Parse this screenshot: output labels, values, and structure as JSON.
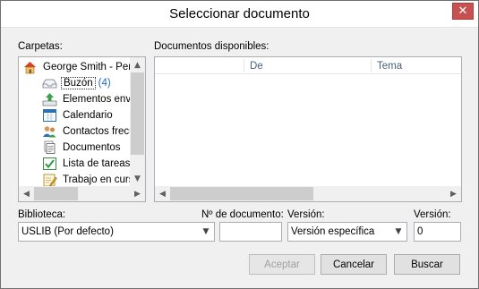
{
  "window": {
    "title": "Seleccionar documento",
    "close_glyph": "✕"
  },
  "folders": {
    "label": "Carpetas:",
    "items": [
      {
        "label": "George Smith - Perso",
        "icon": "home-icon",
        "count": ""
      },
      {
        "label": "Buzón",
        "icon": "inbox-icon",
        "count": "(4)"
      },
      {
        "label": "Elementos envia",
        "icon": "sent-items-icon",
        "count": ""
      },
      {
        "label": "Calendario",
        "icon": "calendar-icon",
        "count": ""
      },
      {
        "label": "Contactos frecue",
        "icon": "contacts-icon",
        "count": ""
      },
      {
        "label": "Documentos",
        "icon": "documents-icon",
        "count": ""
      },
      {
        "label": "Lista de tareas",
        "icon": "task-list-icon",
        "count": ""
      },
      {
        "label": "Trabajo en curso",
        "icon": "work-in-progress-icon",
        "count": ""
      }
    ]
  },
  "documents": {
    "label": "Documentos disponibles:",
    "columns": [
      "",
      "De",
      "Tema"
    ]
  },
  "library": {
    "label": "Biblioteca:",
    "value": "USLIB  (Por defecto)"
  },
  "doc_number": {
    "label": "Nº de documento:",
    "value": ""
  },
  "version_type": {
    "label": "Versión:",
    "value": "Versión específica"
  },
  "version_number": {
    "label": "Versión:",
    "value": "0"
  },
  "buttons": {
    "accept": "Aceptar",
    "cancel": "Cancelar",
    "search": "Buscar"
  },
  "glyphs": {
    "up": "▲",
    "down": "▼",
    "left": "◀",
    "right": "▶",
    "chevron": "▼"
  },
  "colors": {
    "accent": "#1b6ac9",
    "close": "#c75050"
  }
}
